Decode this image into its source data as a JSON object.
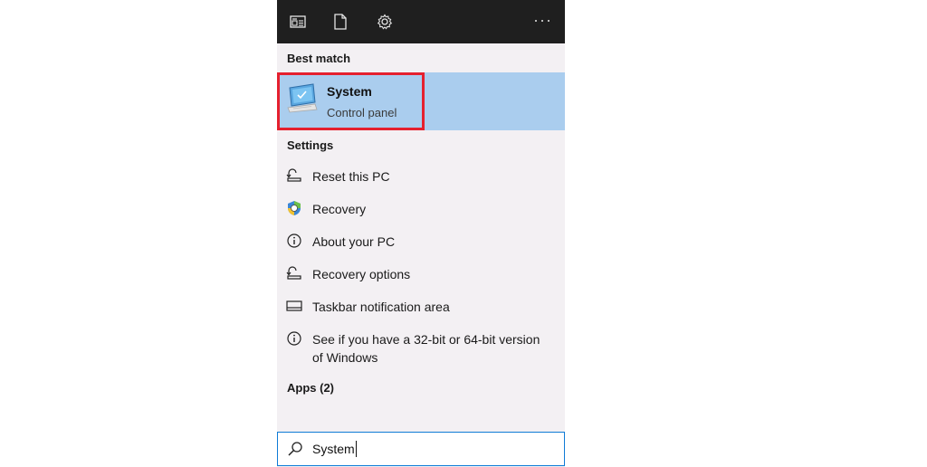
{
  "topbar": {
    "icons": [
      "news-icon",
      "document-icon",
      "settings-icon"
    ],
    "more_label": "···"
  },
  "best_match": {
    "header": "Best match",
    "title": "System",
    "subtitle": "Control panel",
    "highlight_color": "#e5202e",
    "background_color": "#aacdee"
  },
  "settings": {
    "header": "Settings",
    "items": [
      {
        "label": "Reset this PC",
        "icon": "reset-pc-icon"
      },
      {
        "label": "Recovery",
        "icon": "recovery-icon"
      },
      {
        "label": "About your PC",
        "icon": "info-icon"
      },
      {
        "label": "Recovery options",
        "icon": "reset-pc-icon"
      },
      {
        "label": "Taskbar notification area",
        "icon": "taskbar-icon"
      },
      {
        "label": "See if you have a 32-bit or 64-bit version of Windows",
        "icon": "info-icon"
      }
    ]
  },
  "apps": {
    "header": "Apps (2)"
  },
  "search": {
    "value": "System",
    "border_color": "#0f7bd6"
  }
}
